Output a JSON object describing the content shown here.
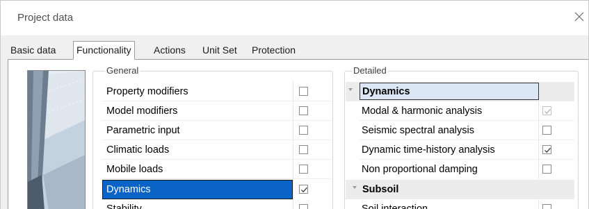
{
  "window": {
    "title": "Project data"
  },
  "tabs": [
    {
      "label": "Basic data",
      "active": false
    },
    {
      "label": "Functionality",
      "active": true
    },
    {
      "label": "Actions",
      "active": false
    },
    {
      "label": "Unit Set",
      "active": false
    },
    {
      "label": "Protection",
      "active": false
    }
  ],
  "general": {
    "label": "General",
    "items": [
      {
        "label": "Property modifiers",
        "checked": false,
        "selected": false
      },
      {
        "label": "Model modifiers",
        "checked": false,
        "selected": false
      },
      {
        "label": "Parametric input",
        "checked": false,
        "selected": false
      },
      {
        "label": "Climatic loads",
        "checked": false,
        "selected": false
      },
      {
        "label": "Mobile loads",
        "checked": false,
        "selected": false
      },
      {
        "label": "Dynamics",
        "checked": true,
        "selected": true
      },
      {
        "label": "Stability",
        "checked": false,
        "selected": false
      }
    ]
  },
  "detailed": {
    "label": "Detailed",
    "categories": [
      {
        "label": "Dynamics",
        "editing": true,
        "items": [
          {
            "label": "Modal & harmonic analysis",
            "checked": true,
            "disabled": true
          },
          {
            "label": "Seismic spectral analysis",
            "checked": false,
            "disabled": false
          },
          {
            "label": "Dynamic time-history analysis",
            "checked": true,
            "disabled": false
          },
          {
            "label": "Non proportional damping",
            "checked": false,
            "disabled": false
          }
        ]
      },
      {
        "label": "Subsoil",
        "editing": false,
        "items": [
          {
            "label": "Soil interaction",
            "checked": false,
            "disabled": false
          }
        ]
      }
    ]
  },
  "colors": {
    "selection": "#0a64c8",
    "category_bg": "#ececec",
    "edit_bg": "#dbe7f5"
  }
}
